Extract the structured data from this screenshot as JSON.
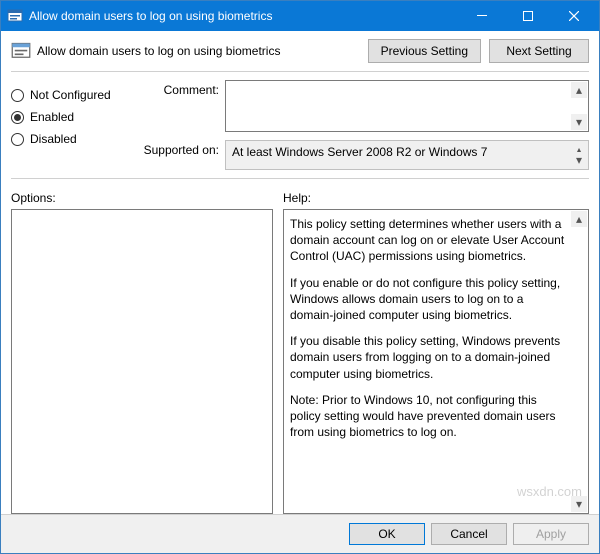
{
  "title": "Allow domain users to log on using biometrics",
  "header": {
    "title": "Allow domain users to log on using biometrics",
    "prev": "Previous Setting",
    "next": "Next Setting"
  },
  "state": {
    "not_configured": "Not Configured",
    "enabled": "Enabled",
    "disabled": "Disabled",
    "selected": "enabled"
  },
  "fields": {
    "comment_label": "Comment:",
    "comment_value": "",
    "supported_label": "Supported on:",
    "supported_value": "At least Windows Server 2008 R2 or Windows 7"
  },
  "panels": {
    "options_label": "Options:",
    "help_label": "Help:",
    "help_paragraphs": [
      "This policy setting determines whether users with a domain account can log on or elevate User Account Control (UAC) permissions using biometrics.",
      "If you enable or do not configure this policy setting, Windows allows domain users to log on to a domain-joined computer using biometrics.",
      "If you disable this policy setting, Windows prevents domain users from logging on to a domain-joined computer using biometrics.",
      "Note: Prior to Windows 10, not configuring this policy setting would have prevented domain users from using biometrics to log on."
    ]
  },
  "footer": {
    "ok": "OK",
    "cancel": "Cancel",
    "apply": "Apply"
  },
  "watermark": "wsxdn.com"
}
